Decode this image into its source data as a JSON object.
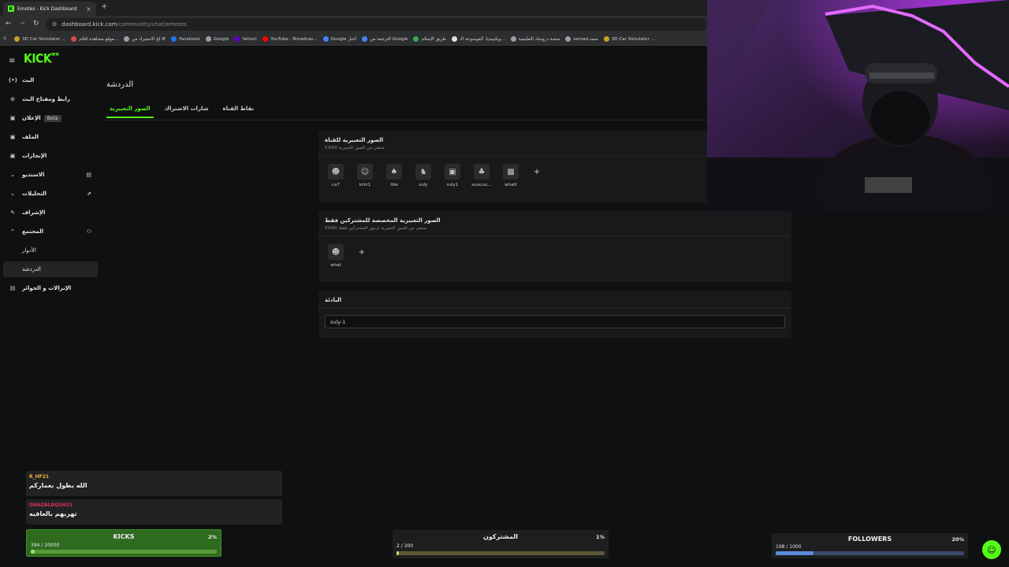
{
  "browser": {
    "tab_title": "Emotes - Kick Dashboard",
    "tab_close": "×",
    "new_tab": "+",
    "url_domain": "dashboard.kick.com",
    "url_path": "/community/chat/emotes",
    "nav_back": "←",
    "nav_forward": "→",
    "nav_reload": "↻",
    "bookmarks": [
      {
        "label": "3D Car Simulator ...",
        "color": "#c9a227"
      },
      {
        "label": "موقع مشاهدة افلام...",
        "color": "#d84b4b"
      },
      {
        "label": "لخ الاستيراد من IE",
        "color": "#9aa0a6"
      },
      {
        "label": "Facebook",
        "color": "#1877f2"
      },
      {
        "label": "Google",
        "color": "#9aa0a6"
      },
      {
        "label": "Yahoo!",
        "color": "#6001d2"
      },
      {
        "label": "YouTube - Broadcas...",
        "color": "#ff0000"
      },
      {
        "label": "Google أخبار",
        "color": "#4285f4"
      },
      {
        "label": "الترجمة من Google",
        "color": "#4285f4"
      },
      {
        "label": "طريق الإسلام",
        "color": "#3aa757"
      },
      {
        "label": "ويكيبيديا، الموسوعة الـ...",
        "color": "#e0e0e0"
      },
      {
        "label": "منصة دروسك التعليمية",
        "color": "#9aa0a6"
      },
      {
        "label": "samad.سمد",
        "color": "#9aa0a6"
      },
      {
        "label": "3D Car Simulator ...",
        "color": "#c9a227"
      }
    ]
  },
  "sidebar": {
    "logo": "KICK",
    "logo_sup": "BETA",
    "items": [
      {
        "label": "البث",
        "icon": "(•)"
      },
      {
        "label": "رابط ومفتاح البث",
        "icon": "⊘"
      },
      {
        "label": "الإعلان",
        "icon": "▣",
        "badge": "Beta"
      },
      {
        "label": "الملف",
        "icon": "▣"
      },
      {
        "label": "الإنجازات",
        "icon": "▣"
      },
      {
        "label": "الاستديو",
        "icon": "⌄",
        "right_icon": "▤"
      },
      {
        "label": "التحليلات",
        "icon": "⌄",
        "right_icon": "⇗"
      },
      {
        "label": "الإشراف",
        "icon": "✎"
      },
      {
        "label": "المجتمع",
        "icon": "⌃",
        "right_icon": "⚇"
      },
      {
        "label": "الأدوار"
      },
      {
        "label": "الدردشة"
      },
      {
        "label": "الإنزالات و الجوائز",
        "icon": "▤"
      }
    ]
  },
  "page": {
    "title": "الدردشة",
    "tabs": [
      "الصور التعبيرية",
      "شارات الاشتراك",
      "نقاط القناة"
    ]
  },
  "channel_emotes": {
    "title": "الصور التعبيرية للقناة",
    "subtitle": "53/60 متبقي من الصور التعبيرية",
    "emotes": [
      "ca7",
      "krkr1",
      "like",
      "suly",
      "suly1",
      "suuuuu...",
      "whatt"
    ]
  },
  "sub_emotes": {
    "title": "الصور التعبيرية المخصصة للمشتركين فقط",
    "subtitle": "59/60 متبقي من الصور التعبيرية لرموز المشتركين فقط",
    "emotes": [
      "what"
    ]
  },
  "prefix": {
    "title": "البادئة",
    "value": "suly-1"
  },
  "add_label": "+",
  "overlay": {
    "chat": [
      {
        "user": "R_HF21",
        "user_color": "#f2b53a",
        "text": "الله يطول بعماركم"
      },
      {
        "user": "GHAZALDQ1H21",
        "user_color": "#e0305a",
        "text": "تهربهم بالعافيه"
      }
    ],
    "goals": [
      {
        "title": "KICKS",
        "count": "394 / 20000",
        "pct": "2%",
        "progress": 0.02
      },
      {
        "title": "المشتركون",
        "count": "2 / 300",
        "pct": "1%",
        "progress": 0.01
      },
      {
        "title": "FOLLOWERS",
        "count": "198 / 1000",
        "pct": "20%",
        "progress": 0.2
      }
    ]
  },
  "colors": {
    "accent": "#53fc18"
  }
}
